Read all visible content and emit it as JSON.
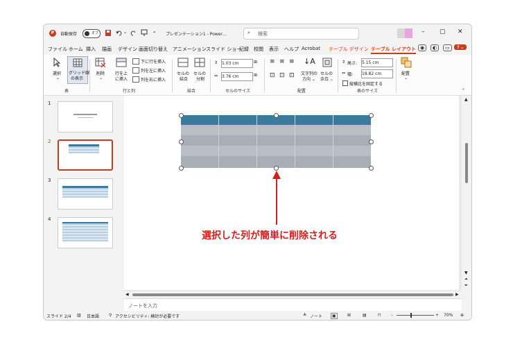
{
  "title": {
    "autosave": "自動保存",
    "toggle": "オフ",
    "doc": "プレゼンテーション1 - Power…",
    "search": "検索"
  },
  "menu": [
    "ファイル",
    "ホーム",
    "挿入",
    "描画",
    "デザイン",
    "画面切り替え",
    "アニメーション",
    "スライド ショー",
    "記録",
    "校閲",
    "表示",
    "ヘルプ",
    "Acrobat",
    "テーブル デザイン",
    "テーブル レイアウト"
  ],
  "ribbon": {
    "select": "選択",
    "grid1": "グリッド線",
    "grid2": "の表示",
    "delete": "削除",
    "insert_above1": "行を上",
    "insert_above2": "に挿入",
    "insert_below": "下に行を挿入",
    "insert_left": "列を左に挿入",
    "insert_right": "列を右に挿入",
    "merge1": "セルの",
    "merge2": "結合",
    "split1": "セルの",
    "split2": "分割",
    "height_val": "1.03 cm",
    "width_val": "3.76 cm",
    "text_dir1": "文字列の",
    "text_dir2": "方向 ⌄",
    "margins1": "セルの",
    "margins2": "余白 ⌄",
    "tbl_height_label": "高さ:",
    "tbl_height_val": "5.15 cm",
    "tbl_width_label": "幅:",
    "tbl_width_val": "18.82 cm",
    "lock_aspect": "縦横比を固定する",
    "arrange": "配置",
    "groups": {
      "table": "表",
      "rows_cols": "行と列",
      "merge": "結合",
      "cell_size": "セルのサイズ",
      "alignment": "配置",
      "table_size": "表のサイズ"
    }
  },
  "slides": [
    "1",
    "2",
    "3",
    "4"
  ],
  "callout": "選択した列が簡単に削除される",
  "notes_placeholder": "ノートを入力",
  "status": {
    "slide": "スライド 2/4",
    "lang": "日本語",
    "access": "アクセシビリティ: 検討が必要です",
    "notes": "ノート",
    "zoom": "70%"
  },
  "colors": {
    "accent": "#c43e1c",
    "table_header": "#3a7b9c",
    "callout": "#d61e1e"
  }
}
